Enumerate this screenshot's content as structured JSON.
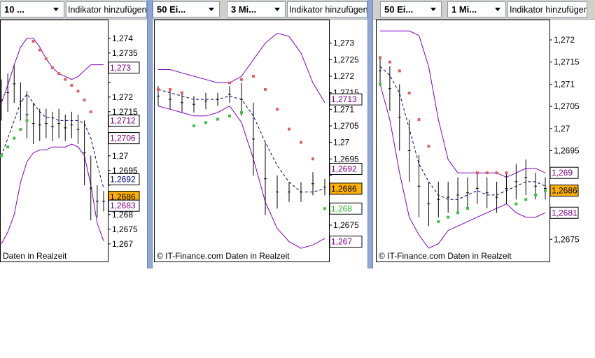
{
  "panels": [
    {
      "id": "p1",
      "period": "10 ...",
      "add_indicator": "Indikator hinzufügen",
      "copyright": "Daten in Realzeit",
      "axis": {
        "ymin": 1.2664,
        "ymax": 1.2744,
        "ticks": [
          1.274,
          1.2735,
          1.273,
          1.2725,
          1.272,
          1.2715,
          1.271,
          1.2705,
          1.27,
          1.2695,
          1.269,
          1.2685,
          1.268,
          1.2675,
          1.267
        ]
      },
      "tick_labels": [
        "1,274",
        "1,2735",
        "",
        "",
        "1,272",
        "1,2715",
        "",
        "",
        "1,27",
        "1,2695",
        "",
        "",
        "1,268",
        "1,2675",
        "1,267"
      ],
      "value_boxes": [
        {
          "label": "1,273",
          "value": 1.273,
          "color": "#800080",
          "bg": "#ffffff"
        },
        {
          "label": "1,2712",
          "value": 1.2712,
          "color": "#800080",
          "bg": "#ffffff"
        },
        {
          "label": "1,2706",
          "value": 1.2706,
          "color": "#800080",
          "bg": "#ffffff"
        },
        {
          "label": "1,2692",
          "value": 1.2692,
          "color": "#000080",
          "bg": "#ffffff"
        },
        {
          "label": "1,2686",
          "value": 1.2686,
          "color": "#000000",
          "bg": "#ffb000"
        },
        {
          "label": "1,2683",
          "value": 1.2683,
          "color": "#800080",
          "bg": "#ffffff"
        }
      ]
    },
    {
      "id": "p2",
      "period": "50 Ei...",
      "interval": "3 Mi...",
      "add_indicator": "Indikator hinzufügen",
      "copyright": "© IT-Finance.com Daten in Realzeit",
      "axis": {
        "ymin": 1.2664,
        "ymax": 1.2735,
        "ticks": [
          1.273,
          1.2725,
          1.272,
          1.2715,
          1.271,
          1.2705,
          1.27,
          1.2695,
          1.269,
          1.2685,
          1.268,
          1.2675,
          1.267
        ]
      },
      "tick_labels": [
        "1,273",
        "1,2725",
        "1,272",
        "1,2715",
        "1,271",
        "1,2705",
        "1,27",
        "1,2695",
        "",
        "",
        "",
        "1,2675",
        ""
      ],
      "value_boxes": [
        {
          "label": "1,2713",
          "value": 1.2713,
          "color": "#800080",
          "bg": "#ffffff"
        },
        {
          "label": "1,2692",
          "value": 1.2692,
          "color": "#800080",
          "bg": "#ffffff"
        },
        {
          "label": "1,2686",
          "value": 1.2686,
          "color": "#000000",
          "bg": "#ffb000"
        },
        {
          "label": "1,268",
          "value": 1.268,
          "color": "#2db82d",
          "bg": "#ffffff"
        },
        {
          "label": "1,267",
          "value": 1.267,
          "color": "#800080",
          "bg": "#ffffff"
        }
      ]
    },
    {
      "id": "p3",
      "period": "50 Ei...",
      "interval": "1 Mi...",
      "add_indicator": "Indikator hinzufügen",
      "copyright": "© IT-Finance.com Daten in Realzeit",
      "axis": {
        "ymin": 1.267,
        "ymax": 1.2723,
        "ticks": [
          1.272,
          1.2715,
          1.271,
          1.2705,
          1.27,
          1.2695,
          1.269,
          1.2685,
          1.268,
          1.2675
        ]
      },
      "tick_labels": [
        "1,272",
        "1,2715",
        "1,271",
        "1,2705",
        "1,27",
        "1,2695",
        "",
        "",
        "",
        "1,2675"
      ],
      "value_boxes": [
        {
          "label": "1,269",
          "value": 1.269,
          "color": "#800080",
          "bg": "#ffffff"
        },
        {
          "label": "1,2686",
          "value": 1.2686,
          "color": "#000000",
          "bg": "#ffb000"
        },
        {
          "label": "1,2681",
          "value": 1.2681,
          "color": "#800080",
          "bg": "#ffffff"
        }
      ]
    }
  ],
  "chart_data": [
    {
      "type": "line",
      "series": [
        {
          "kind": "bollinger_upper",
          "color": "#8000c0",
          "y": [
            1.2718,
            1.2724,
            1.2731,
            1.2737,
            1.274,
            1.274,
            1.2737,
            1.2733,
            1.273,
            1.2728,
            1.2727,
            1.2726,
            1.2727,
            1.2729,
            1.2731,
            1.2731,
            1.2731
          ]
        },
        {
          "kind": "bollinger_lower",
          "color": "#8000c0",
          "y": [
            1.267,
            1.2674,
            1.268,
            1.2691,
            1.2698,
            1.2701,
            1.2702,
            1.2702,
            1.2703,
            1.2703,
            1.2703,
            1.2704,
            1.2703,
            1.27,
            1.269,
            1.2677,
            1.2671
          ]
        },
        {
          "kind": "moving_average",
          "color": "#000080",
          "dash": true,
          "y": [
            1.27,
            1.2706,
            1.2712,
            1.2718,
            1.2721,
            1.2718,
            1.2715,
            1.2713,
            1.2713,
            1.2712,
            1.2712,
            1.2712,
            1.2712,
            1.2711,
            1.2706,
            1.2697,
            1.2689
          ]
        },
        {
          "kind": "sar_red",
          "color": "#e06060",
          "y": [
            null,
            null,
            null,
            null,
            null,
            1.2739,
            1.2736,
            1.2733,
            1.273,
            1.2728,
            1.2726,
            1.2724,
            1.2722,
            1.2719,
            1.2715,
            null,
            null
          ]
        },
        {
          "kind": "sar_green",
          "color": "#40c040",
          "y": [
            1.27,
            1.2703,
            1.2706,
            1.2709,
            1.2712,
            null,
            null,
            null,
            null,
            null,
            null,
            null,
            null,
            null,
            null,
            null,
            null
          ]
        },
        {
          "kind": "price_high",
          "color": "#000000",
          "y": [
            1.2726,
            1.2728,
            1.2731,
            1.2725,
            1.2722,
            1.2718,
            1.2716,
            1.2716,
            1.2715,
            1.2716,
            1.2714,
            1.2715,
            1.2714,
            1.2712,
            1.27,
            1.269,
            1.2688
          ]
        },
        {
          "kind": "price_low",
          "color": "#000000",
          "y": [
            1.2712,
            1.2715,
            1.2718,
            1.2712,
            1.2706,
            1.2704,
            1.2705,
            1.2706,
            1.2705,
            1.2706,
            1.2705,
            1.2706,
            1.2704,
            1.269,
            1.2678,
            1.2679,
            1.2681
          ]
        }
      ]
    },
    {
      "type": "line",
      "series": [
        {
          "kind": "bollinger_upper",
          "color": "#8000c0",
          "y": [
            1.2722,
            1.2722,
            1.2721,
            1.272,
            1.2719,
            1.2718,
            1.2718,
            1.272,
            1.2725,
            1.273,
            1.2733,
            1.2732,
            1.2727,
            1.2718,
            1.2712
          ]
        },
        {
          "kind": "bollinger_lower",
          "color": "#8000c0",
          "y": [
            1.2711,
            1.271,
            1.2709,
            1.2708,
            1.2708,
            1.2709,
            1.2711,
            1.2706,
            1.2695,
            1.2682,
            1.2674,
            1.267,
            1.2668,
            1.2669,
            1.2671
          ]
        },
        {
          "kind": "moving_average",
          "color": "#000080",
          "dash": true,
          "y": [
            1.2716,
            1.2715,
            1.2714,
            1.2713,
            1.2713,
            1.2713,
            1.2714,
            1.2713,
            1.2708,
            1.27,
            1.2693,
            1.2688,
            1.2685,
            1.2685,
            1.2686
          ]
        },
        {
          "kind": "sar_red",
          "color": "#e06060",
          "y": [
            1.2716,
            1.2716,
            1.2715,
            null,
            null,
            null,
            1.2718,
            1.2719,
            1.272,
            1.2716,
            1.271,
            1.2704,
            1.27,
            1.2695,
            null
          ]
        },
        {
          "kind": "sar_green",
          "color": "#40c040",
          "y": [
            null,
            null,
            null,
            1.2705,
            1.2706,
            1.2707,
            1.2708,
            1.2709,
            null,
            null,
            null,
            null,
            null,
            null,
            1.268
          ]
        },
        {
          "kind": "price_high",
          "color": "#000000",
          "y": [
            1.2717,
            1.2716,
            1.2715,
            1.2714,
            1.2715,
            1.2715,
            1.2717,
            1.2718,
            1.2712,
            1.27,
            1.269,
            1.2688,
            1.2688,
            1.2691,
            1.2689
          ]
        },
        {
          "kind": "price_low",
          "color": "#000000",
          "y": [
            1.2711,
            1.271,
            1.2709,
            1.2709,
            1.271,
            1.2711,
            1.2712,
            1.2708,
            1.269,
            1.2678,
            1.268,
            1.2682,
            1.2682,
            1.2684,
            1.2684
          ]
        }
      ]
    },
    {
      "type": "line",
      "series": [
        {
          "kind": "bollinger_upper",
          "color": "#8000c0",
          "y": [
            1.2722,
            1.2722,
            1.2722,
            1.2722,
            1.2721,
            1.2714,
            1.2702,
            1.2693,
            1.269,
            1.269,
            1.269,
            1.269,
            1.269,
            1.2689,
            1.269,
            1.2691,
            1.2691,
            1.269
          ]
        },
        {
          "kind": "bollinger_lower",
          "color": "#8000c0",
          "y": [
            1.271,
            1.2702,
            1.269,
            1.268,
            1.2676,
            1.2673,
            1.2674,
            1.2677,
            1.2678,
            1.2679,
            1.268,
            1.2681,
            1.2682,
            1.2683,
            1.2681,
            1.268,
            1.268,
            1.2681
          ]
        },
        {
          "kind": "moving_average",
          "color": "#000080",
          "dash": true,
          "y": [
            1.2714,
            1.2712,
            1.2708,
            1.27,
            1.2692,
            1.2688,
            1.2685,
            1.2684,
            1.2684,
            1.2685,
            1.2686,
            1.2685,
            1.2685,
            1.2686,
            1.2687,
            1.2688,
            1.2688,
            1.2687
          ]
        },
        {
          "kind": "sar_red",
          "color": "#e06060",
          "y": [
            1.2716,
            1.2715,
            1.2713,
            1.2708,
            1.2702,
            1.2696,
            null,
            null,
            null,
            null,
            1.269,
            1.269,
            1.269,
            1.269,
            null,
            null,
            null,
            null
          ]
        },
        {
          "kind": "sar_green",
          "color": "#40c040",
          "y": [
            1.271,
            null,
            null,
            null,
            null,
            null,
            1.2679,
            1.268,
            1.2681,
            1.2682,
            null,
            null,
            null,
            null,
            1.2683,
            1.2684,
            1.2685,
            1.2686
          ]
        },
        {
          "kind": "price_high",
          "color": "#000000",
          "y": [
            1.2716,
            1.2714,
            1.271,
            1.2702,
            1.2694,
            1.2688,
            1.2688,
            1.2688,
            1.2689,
            1.2689,
            1.269,
            1.2689,
            1.2688,
            1.269,
            1.2692,
            1.2693,
            1.269,
            1.2689
          ]
        },
        {
          "kind": "price_low",
          "color": "#000000",
          "y": [
            1.271,
            1.2704,
            1.2695,
            1.2688,
            1.268,
            1.2678,
            1.268,
            1.2681,
            1.2681,
            1.2682,
            1.2683,
            1.2682,
            1.2681,
            1.2683,
            1.2684,
            1.2685,
            1.2684,
            1.2684
          ]
        }
      ]
    }
  ]
}
